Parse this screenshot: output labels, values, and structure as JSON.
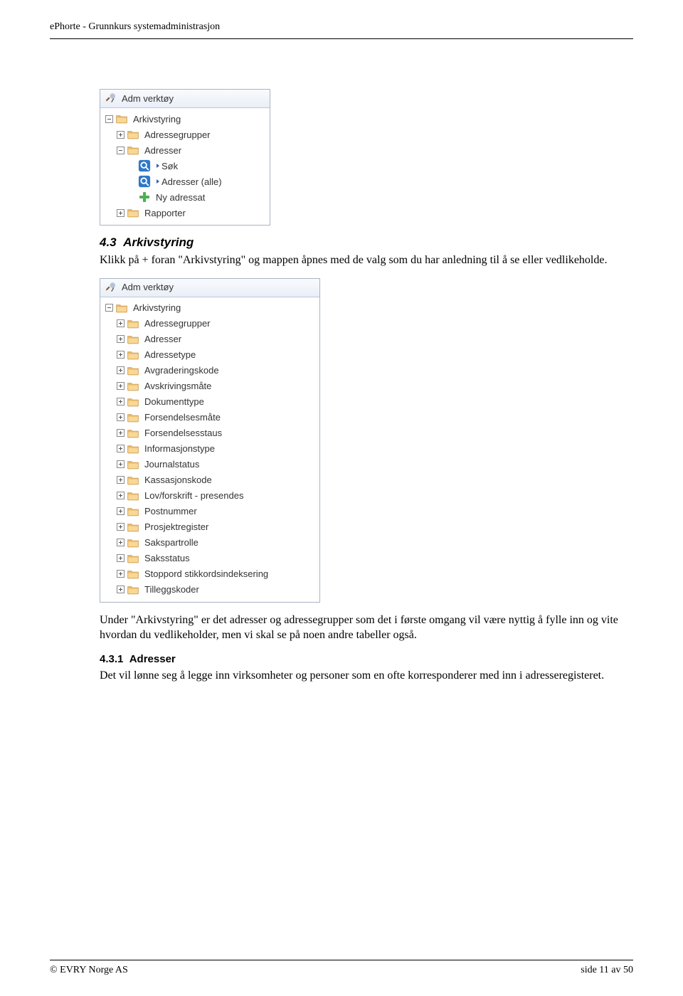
{
  "header": {
    "title": "ePhorte - Grunnkurs systemadministrasjon"
  },
  "panel1": {
    "title": "Adm verktøy",
    "rows": [
      {
        "indent": 0,
        "expander": "minus",
        "icon": "folder",
        "label": "Arkivstyring"
      },
      {
        "indent": 1,
        "expander": "plus",
        "icon": "folder",
        "label": "Adressegrupper"
      },
      {
        "indent": 1,
        "expander": "minus",
        "icon": "folder",
        "label": "Adresser"
      },
      {
        "indent": 2,
        "expander": "",
        "icon": "search",
        "drop": true,
        "label": "Søk"
      },
      {
        "indent": 2,
        "expander": "",
        "icon": "search",
        "drop": true,
        "label": "Adresser (alle)"
      },
      {
        "indent": 2,
        "expander": "",
        "icon": "plus",
        "label": "Ny adressat"
      },
      {
        "indent": 1,
        "expander": "plus",
        "icon": "folder",
        "label": "Rapporter"
      }
    ]
  },
  "section1": {
    "num": "4.3",
    "title": "Arkivstyring",
    "para": "Klikk på + foran \"Arkivstyring\" og mappen åpnes med de valg som du har anledning til å se eller vedlikeholde."
  },
  "panel2": {
    "title": "Adm verktøy",
    "rows": [
      {
        "indent": 0,
        "expander": "minus",
        "icon": "folder",
        "label": "Arkivstyring"
      },
      {
        "indent": 1,
        "expander": "plus",
        "icon": "folder",
        "label": "Adressegrupper"
      },
      {
        "indent": 1,
        "expander": "plus",
        "icon": "folder",
        "label": "Adresser"
      },
      {
        "indent": 1,
        "expander": "plus",
        "icon": "folder",
        "label": "Adressetype"
      },
      {
        "indent": 1,
        "expander": "plus",
        "icon": "folder",
        "label": "Avgraderingskode"
      },
      {
        "indent": 1,
        "expander": "plus",
        "icon": "folder",
        "label": "Avskrivingsmåte"
      },
      {
        "indent": 1,
        "expander": "plus",
        "icon": "folder",
        "label": "Dokumenttype"
      },
      {
        "indent": 1,
        "expander": "plus",
        "icon": "folder",
        "label": "Forsendelsesmåte"
      },
      {
        "indent": 1,
        "expander": "plus",
        "icon": "folder",
        "label": "Forsendelsesstaus"
      },
      {
        "indent": 1,
        "expander": "plus",
        "icon": "folder",
        "label": "Informasjonstype"
      },
      {
        "indent": 1,
        "expander": "plus",
        "icon": "folder",
        "label": "Journalstatus"
      },
      {
        "indent": 1,
        "expander": "plus",
        "icon": "folder",
        "label": "Kassasjonskode"
      },
      {
        "indent": 1,
        "expander": "plus",
        "icon": "folder",
        "label": "Lov/forskrift - presendes"
      },
      {
        "indent": 1,
        "expander": "plus",
        "icon": "folder",
        "label": "Postnummer"
      },
      {
        "indent": 1,
        "expander": "plus",
        "icon": "folder",
        "label": "Prosjektregister"
      },
      {
        "indent": 1,
        "expander": "plus",
        "icon": "folder",
        "label": "Sakspartrolle"
      },
      {
        "indent": 1,
        "expander": "plus",
        "icon": "folder",
        "label": "Saksstatus"
      },
      {
        "indent": 1,
        "expander": "plus",
        "icon": "folder",
        "label": "Stoppord stikkordsindeksering"
      },
      {
        "indent": 1,
        "expander": "plus",
        "icon": "folder",
        "label": "Tilleggskoder"
      }
    ]
  },
  "section2": {
    "para": "Under \"Arkivstyring\" er det adresser og adressegrupper som det i første omgang vil være nyttig å fylle inn og vite hvordan du vedlikeholder, men vi skal se på noen andre tabeller også."
  },
  "section3": {
    "num": "4.3.1",
    "title": "Adresser",
    "para": "Det vil lønne seg å legge inn virksomheter og personer som en ofte korresponderer med inn i adresseregisteret."
  },
  "footer": {
    "left": "© EVRY Norge AS",
    "right": "side 11 av 50"
  }
}
